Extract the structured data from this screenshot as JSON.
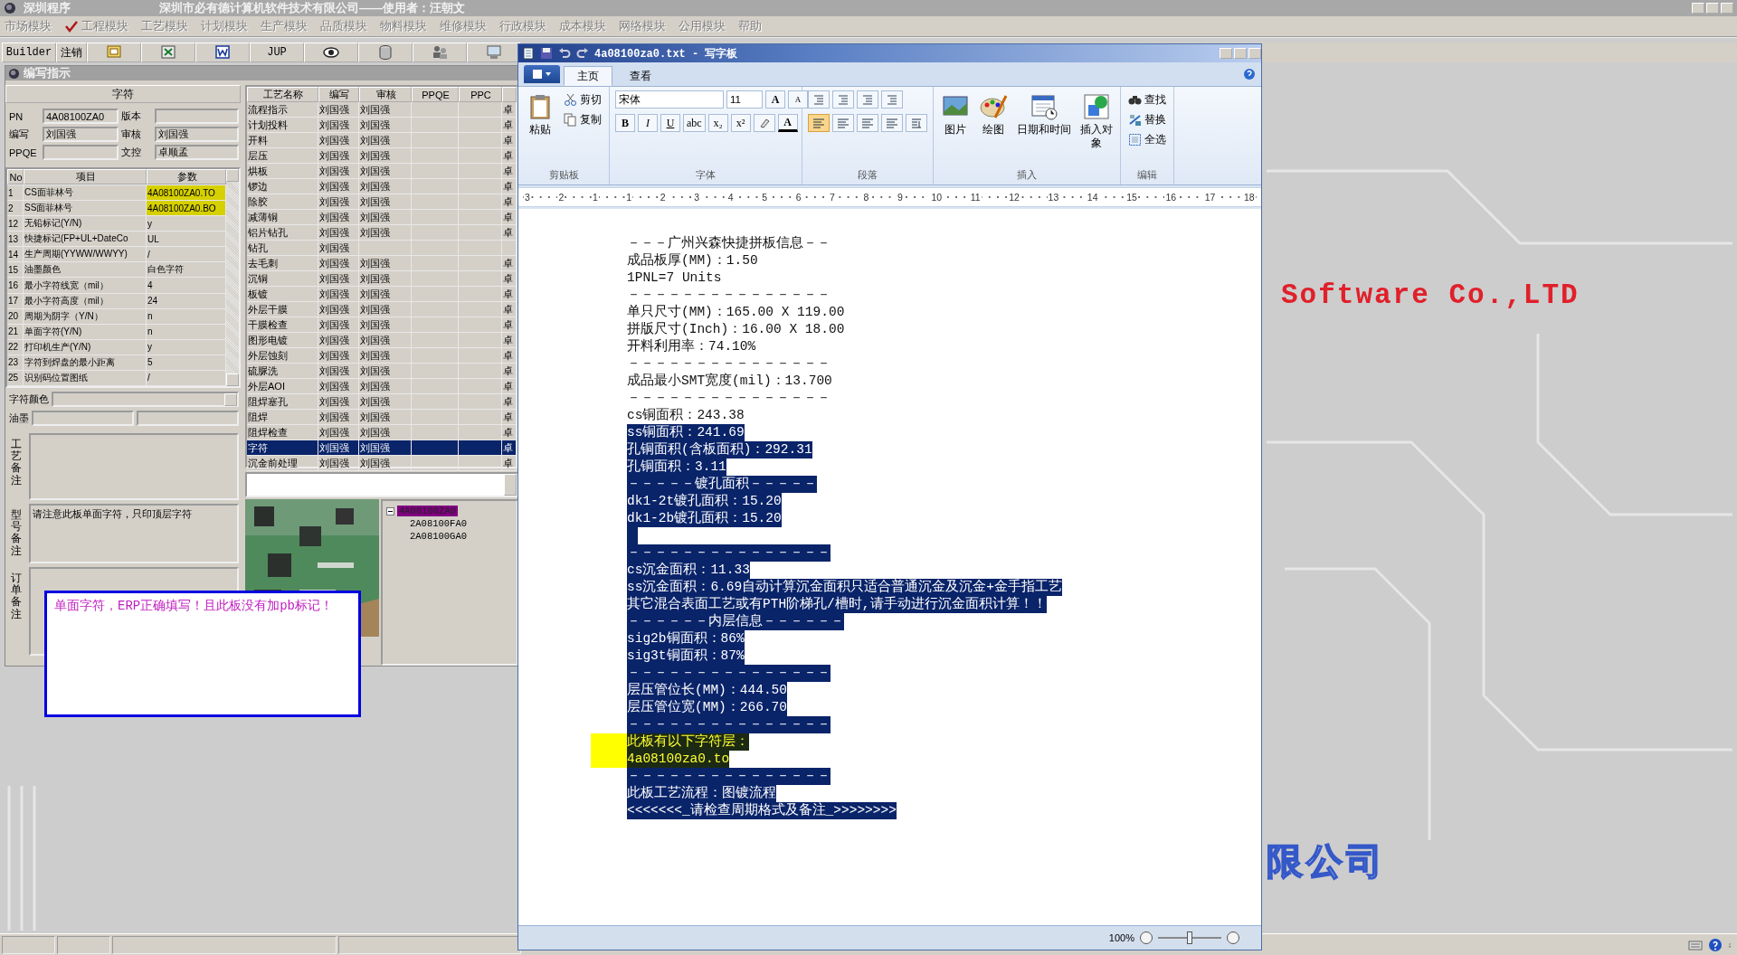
{
  "app": {
    "title": "深圳程序",
    "caption": "深圳市必有德计算机软件技术有限公司——使用者：汪朝文"
  },
  "menu": [
    {
      "label": "市场模块",
      "checked": false
    },
    {
      "label": "工程模块",
      "checked": true
    },
    {
      "label": "工艺模块",
      "checked": false
    },
    {
      "label": "计划模块",
      "checked": false
    },
    {
      "label": "生产模块",
      "checked": false
    },
    {
      "label": "品质模块",
      "checked": false
    },
    {
      "label": "物料模块",
      "checked": false
    },
    {
      "label": "维修模块",
      "checked": false
    },
    {
      "label": "行政模块",
      "checked": false
    },
    {
      "label": "成本模块",
      "checked": false
    },
    {
      "label": "网络模块",
      "checked": false
    },
    {
      "label": "公用模块",
      "checked": false
    },
    {
      "label": "帮助",
      "checked": false
    }
  ],
  "toolbar": [
    {
      "kind": "text",
      "label": "Builder"
    },
    {
      "kind": "text",
      "label": "注销"
    },
    {
      "kind": "icon"
    },
    {
      "kind": "icon"
    },
    {
      "kind": "icon"
    },
    {
      "kind": "text",
      "label": "JUP"
    },
    {
      "kind": "icon"
    },
    {
      "kind": "icon"
    },
    {
      "kind": "icon"
    },
    {
      "kind": "icon"
    }
  ],
  "editor": {
    "title": "编写指示",
    "section": "字符",
    "fields": [
      {
        "label": "PN",
        "value": "4A08100ZA0"
      },
      {
        "label": "版本"
      },
      {
        "label": "编写",
        "value": "刘国强"
      },
      {
        "label": "审核",
        "value": "刘国强"
      },
      {
        "label": "PPQE"
      },
      {
        "label": "文控",
        "value": "卓顺孟"
      }
    ],
    "params": {
      "columns": [
        "No",
        "项目",
        "参数"
      ],
      "rows": [
        {
          "no": "1",
          "item": "CS面菲林号",
          "value": "4A08100ZA0.TO",
          "marked": true
        },
        {
          "no": "2",
          "item": "SS面菲林号",
          "value": "4A08100ZA0.BO",
          "marked": true
        },
        {
          "no": "12",
          "item": "无铅标记(Y/N)",
          "value": "y",
          "marked": false
        },
        {
          "no": "13",
          "item": "快捷标记(FP+UL+DateCo",
          "value": "UL",
          "marked": false
        },
        {
          "no": "14",
          "item": "生产周期(YYWW/WWYY)",
          "value": "/",
          "marked": false
        },
        {
          "no": "15",
          "item": "油墨颜色",
          "value": "白色字符",
          "marked": false
        },
        {
          "no": "16",
          "item": "最小字符线宽（mil）",
          "value": "4",
          "marked": false
        },
        {
          "no": "17",
          "item": "最小字符高度（mil）",
          "value": "24",
          "marked": false
        },
        {
          "no": "20",
          "item": "周期为阴字（Y/N）",
          "value": "n",
          "marked": false
        },
        {
          "no": "21",
          "item": "单面字符(Y/N)",
          "value": "n",
          "marked": false
        },
        {
          "no": "22",
          "item": "打印机生产(Y/N)",
          "value": "y",
          "marked": false
        },
        {
          "no": "23",
          "item": "字符到焊盘的最小距离",
          "value": "5",
          "marked": false
        },
        {
          "no": "25",
          "item": "识别码位置图纸",
          "value": "/",
          "marked": false
        }
      ]
    },
    "color_field": {
      "label": "字符颜色"
    },
    "ink_field": {
      "label": "油墨"
    },
    "notes": [
      {
        "label": "工艺备注"
      },
      {
        "label": "型号备注",
        "value": "请注意此板单面字符，只印顶层字符"
      },
      {
        "label": "订单备注"
      }
    ]
  },
  "process": {
    "columns": [
      "工艺名称",
      "编写",
      "审核",
      "PPQE",
      "PPC"
    ],
    "rows": [
      {
        "name": "流程指示",
        "writer": "刘国强",
        "reviewer": "刘国强",
        "column_6": "卓",
        "selected": false
      },
      {
        "name": "计划投料",
        "writer": "刘国强",
        "reviewer": "刘国强",
        "column_6": "卓",
        "selected": false
      },
      {
        "name": "开料",
        "writer": "刘国强",
        "reviewer": "刘国强",
        "column_6": "卓",
        "selected": false
      },
      {
        "name": "层压",
        "writer": "刘国强",
        "reviewer": "刘国强",
        "column_6": "卓",
        "selected": false
      },
      {
        "name": "烘板",
        "writer": "刘国强",
        "reviewer": "刘国强",
        "column_6": "卓",
        "selected": false
      },
      {
        "name": "锣边",
        "writer": "刘国强",
        "reviewer": "刘国强",
        "column_6": "卓",
        "selected": false
      },
      {
        "name": "除胶",
        "writer": "刘国强",
        "reviewer": "刘国强",
        "column_6": "卓",
        "selected": false
      },
      {
        "name": "减薄铜",
        "writer": "刘国强",
        "reviewer": "刘国强",
        "column_6": "卓",
        "selected": false
      },
      {
        "name": "铝片钻孔",
        "writer": "刘国强",
        "reviewer": "刘国强",
        "column_6": "卓",
        "selected": false
      },
      {
        "name": "钻孔",
        "writer": "刘国强",
        "selected": false
      },
      {
        "name": "去毛刺",
        "writer": "刘国强",
        "reviewer": "刘国强",
        "column_6": "卓",
        "selected": false
      },
      {
        "name": "沉铜",
        "writer": "刘国强",
        "reviewer": "刘国强",
        "column_6": "卓",
        "selected": false
      },
      {
        "name": "板镀",
        "writer": "刘国强",
        "reviewer": "刘国强",
        "column_6": "卓",
        "selected": false
      },
      {
        "name": "外层干膜",
        "writer": "刘国强",
        "reviewer": "刘国强",
        "column_6": "卓",
        "selected": false
      },
      {
        "name": "干膜检查",
        "writer": "刘国强",
        "reviewer": "刘国强",
        "column_6": "卓",
        "selected": false
      },
      {
        "name": "图形电镀",
        "writer": "刘国强",
        "reviewer": "刘国强",
        "column_6": "卓",
        "selected": false
      },
      {
        "name": "外层蚀刻",
        "writer": "刘国强",
        "reviewer": "刘国强",
        "column_6": "卓",
        "selected": false
      },
      {
        "name": "硫脲洗",
        "writer": "刘国强",
        "reviewer": "刘国强",
        "column_6": "卓",
        "selected": false
      },
      {
        "name": "外层AOI",
        "writer": "刘国强",
        "reviewer": "刘国强",
        "column_6": "卓",
        "selected": false
      },
      {
        "name": "阻焊塞孔",
        "writer": "刘国强",
        "reviewer": "刘国强",
        "column_6": "卓",
        "selected": false
      },
      {
        "name": "阻焊",
        "writer": "刘国强",
        "reviewer": "刘国强",
        "column_6": "卓",
        "selected": false
      },
      {
        "name": "阻焊检查",
        "writer": "刘国强",
        "reviewer": "刘国强",
        "column_6": "卓",
        "selected": false
      },
      {
        "name": "字符",
        "writer": "刘国强",
        "reviewer": "刘国强",
        "column_6": "卓",
        "selected": true
      },
      {
        "name": "沉金前处理",
        "writer": "刘国强",
        "reviewer": "刘国强",
        "column_6": "卓",
        "selected": false
      }
    ]
  },
  "tree": [
    {
      "label": "4A08100ZA0",
      "selected": true,
      "expanded": true,
      "children": [
        {
          "label": "2A08100FA0",
          "selected": false
        },
        {
          "label": "2A08100GA0",
          "selected": false
        }
      ]
    }
  ],
  "alert": {
    "message": "单面字符，ERP正确填写！且此板没有加pb标记！"
  },
  "wallpaper": {
    "company_en": "Software Co.,LTD",
    "company_cn": "限公司"
  },
  "wordpad": {
    "title": "4a08100za0.txt - 写字板",
    "tabs": [
      {
        "label": "主页",
        "selected": true
      },
      {
        "label": "查看",
        "selected": false
      }
    ],
    "clipboard": {
      "paste": "粘贴",
      "cut": "剪切",
      "copy": "复制",
      "group": "剪贴板"
    },
    "font": {
      "family": "宋体",
      "size": "11",
      "grow": "A",
      "shrink": "A",
      "format": [
        "B",
        "I",
        "U",
        "abc",
        "x₂",
        "x²"
      ],
      "fg_button": "A",
      "group": "字体"
    },
    "paragraph": {
      "group": "段落",
      "align": [
        {
          "selected": true
        },
        {
          "selected": false
        },
        {
          "selected": false
        },
        {
          "selected": false
        }
      ]
    },
    "insert": {
      "group": "插入",
      "items": [
        "图片",
        "绘图",
        "日期和时间",
        "插入对象"
      ]
    },
    "editing": {
      "group": "编辑",
      "items": [
        "查找",
        "替换",
        "全选"
      ]
    },
    "ruler": [
      "3",
      "2",
      "1",
      "1",
      "2",
      "3",
      "4",
      "5",
      "6",
      "7",
      "8",
      "9",
      "10",
      "11",
      "12",
      "13",
      "14",
      "15",
      "16",
      "17",
      "18"
    ],
    "lines": [
      {
        "text": "－－－广州兴森快捷拼板信息－－",
        "selected": false,
        "marked": false
      },
      {
        "text": "成品板厚(MM)：1.50",
        "selected": false,
        "marked": false
      },
      {
        "text": "1PNL=7 Units",
        "selected": false,
        "marked": false
      },
      {
        "text": "－－－－－－－－－－－－－－－",
        "selected": false,
        "marked": false
      },
      {
        "text": "单只尺寸(MM)：165.00 X 119.00",
        "selected": false,
        "marked": false
      },
      {
        "text": "拼版尺寸(Inch)：16.00 X 18.00",
        "selected": false,
        "marked": false
      },
      {
        "text": "开料利用率：74.10%",
        "selected": false,
        "marked": false
      },
      {
        "text": "－－－－－－－－－－－－－－－",
        "selected": false,
        "marked": false
      },
      {
        "text": "成品最小SMT宽度(mil)：13.700",
        "selected": false,
        "marked": false
      },
      {
        "text": "－－－－－－－－－－－－－－－",
        "selected": false,
        "marked": false
      },
      {
        "text": "cs铜面积：243.38",
        "selected": false,
        "marked": false
      },
      {
        "text": "ss铜面积：241.69",
        "selected": true,
        "marked": false
      },
      {
        "text": "孔铜面积(含板面积)：292.31",
        "selected": true,
        "marked": false
      },
      {
        "text": "孔铜面积：3.11",
        "selected": true,
        "marked": false
      },
      {
        "text": "－－－－－镀孔面积－－－－－",
        "selected": true,
        "marked": false
      },
      {
        "text": "dk1-2t镀孔面积：15.20",
        "selected": true,
        "marked": false
      },
      {
        "text": "dk1-2b镀孔面积：15.20",
        "selected": true,
        "marked": false
      },
      {
        "kind": "blank",
        "selected": true,
        "marked": false
      },
      {
        "text": "－－－－－－－－－－－－－－－",
        "selected": true,
        "marked": false
      },
      {
        "text": "cs沉金面积：11.33",
        "selected": true,
        "marked": false
      },
      {
        "text": "ss沉金面积：6.69自动计算沉金面积只适合普通沉金及沉金+金手指工艺",
        "selected": true,
        "marked": false
      },
      {
        "text": "其它混合表面工艺或有PTH阶梯孔/槽时,请手动进行沉金面积计算！！",
        "selected": true,
        "marked": false
      },
      {
        "text": "－－－－－－内层信息－－－－－－",
        "selected": true,
        "marked": false
      },
      {
        "text": "sig2b铜面积：86%",
        "selected": true,
        "marked": false
      },
      {
        "text": "sig3t铜面积：87%",
        "selected": true,
        "marked": false
      },
      {
        "text": "－－－－－－－－－－－－－－－",
        "selected": true,
        "marked": false
      },
      {
        "text": "层压管位长(MM)：444.50",
        "selected": true,
        "marked": false
      },
      {
        "text": "层压管位宽(MM)：266.70",
        "selected": true,
        "marked": false
      },
      {
        "text": "－－－－－－－－－－－－－－－",
        "selected": true,
        "marked": false
      },
      {
        "text": "此板有以下字符层：",
        "selected": true,
        "marked": true
      },
      {
        "text": "4a08100za0.to",
        "selected": true,
        "marked": true
      },
      {
        "text": "－－－－－－－－－－－－－－－",
        "selected": true,
        "marked": false
      },
      {
        "text": "此板工艺流程：图镀流程",
        "selected": true,
        "marked": false
      },
      {
        "text": "<<<<<<<_请检查周期格式及备注_>>>>>>>>",
        "selected": true,
        "marked": false
      }
    ],
    "zoom": {
      "label": "100%",
      "level": 0.5
    }
  }
}
